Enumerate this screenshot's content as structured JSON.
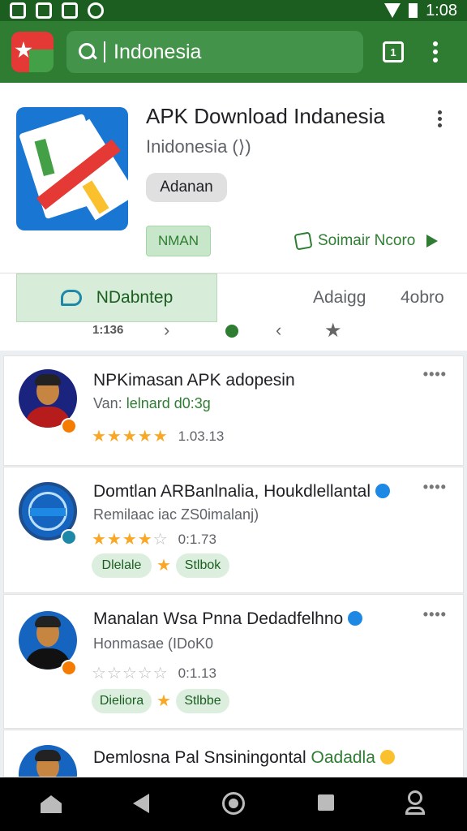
{
  "status_bar": {
    "time": "1:08"
  },
  "toolbar": {
    "search_value": "Indonesia",
    "tab_count": "1"
  },
  "app": {
    "title": "APK Download Indanesia",
    "subtitle": "Inidonesia (⟩)",
    "chip": "Adanan",
    "install_button": "NMAN",
    "summary_link": "Soimair Ncoro"
  },
  "tabs": {
    "active": "NDabntep",
    "second": "Adaigg",
    "third": "4obro"
  },
  "pager": {
    "number": "1:136",
    "prev_glyph": "›",
    "next_glyph": "‹",
    "star_glyph": "★"
  },
  "list": [
    {
      "title": "NPKimasan APK adopesin",
      "subtitle_prefix": "Van: ",
      "subtitle_highlight": "lelnard  d0:3g",
      "stars_filled": 5,
      "rating_value": "1.03.13"
    },
    {
      "title": "Domtlan ARBanlnalia, Houkdlellantal",
      "subtitle": "Remilaac iac ZS0imalanj)",
      "stars_filled": 3.5,
      "rating_value": "0:1.73",
      "pill_1": "Dlelale",
      "pill_2": "Stlbok"
    },
    {
      "title": "Manalan Wsa  Pnna Dedadfelhno",
      "subtitle": "Honmasae (IDoK0",
      "stars_filled": 0,
      "rating_value": "0:1.13",
      "pill_1": "Dieliora",
      "pill_2": "Stlbbe"
    },
    {
      "title": "Demlosna Pal Snsiningontal",
      "title_highlight": "Oadadla"
    }
  ],
  "colors": {
    "primary": "#2e7d32",
    "primary_dark": "#1b5e20",
    "star": "#f9a825",
    "accent_blue": "#1e88e5"
  },
  "icons": [
    "search-icon",
    "tabs-icon",
    "overflow-icon",
    "summary-icon",
    "play-icon",
    "chat-icon",
    "home-icon",
    "back-icon",
    "home-button-icon",
    "recent-apps-icon",
    "user-icon"
  ]
}
